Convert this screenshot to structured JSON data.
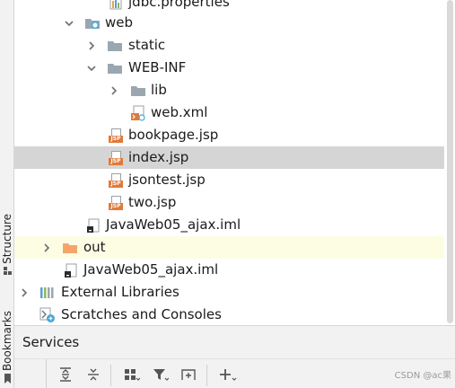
{
  "side_tabs": {
    "structure": "Structure",
    "bookmarks": "Bookmarks"
  },
  "tree": {
    "partial_item": "jdbc.properties",
    "web": "web",
    "static": "static",
    "web_inf": "WEB-INF",
    "lib": "lib",
    "web_xml": "web.xml",
    "bookpage_jsp": "bookpage.jsp",
    "index_jsp": "index.jsp",
    "jsontest_jsp": "jsontest.jsp",
    "two_jsp": "two.jsp",
    "module_iml": "JavaWeb05_ajax.iml",
    "out": "out",
    "root_iml": "JavaWeb05_ajax.iml",
    "external_libraries": "External Libraries",
    "scratches": "Scratches and Consoles",
    "jsp_badge": "JSP"
  },
  "services": {
    "title": "Services"
  },
  "watermark": "CSDN @ac果",
  "colors": {
    "selected_row": "#d5d5d5",
    "excluded_row": "#fdfde4",
    "folder": "#9aa7b0",
    "excluded_folder": "#f4a66a",
    "jsp_badge": "#e07a3a",
    "web_folder_accent": "#40a9dc"
  }
}
